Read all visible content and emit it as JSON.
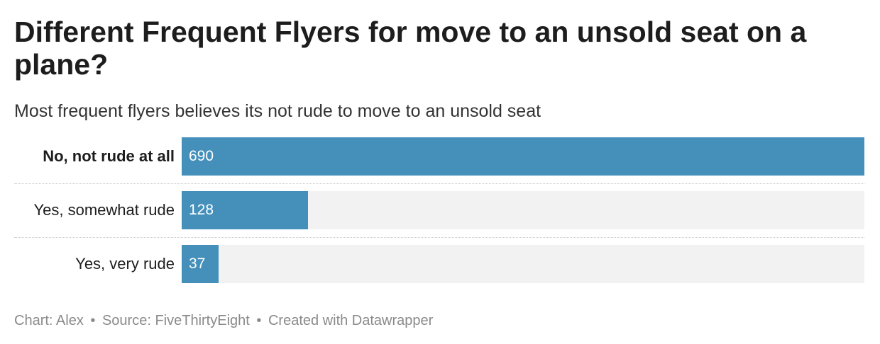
{
  "chart_data": {
    "type": "bar",
    "orientation": "horizontal",
    "title": "Different Frequent Flyers for move to an unsold seat on a plane?",
    "subtitle": "Most frequent flyers believes its not rude to move to an unsold seat",
    "categories": [
      "No, not rude at all",
      "Yes, somewhat rude",
      "Yes, very rude"
    ],
    "values": [
      690,
      128,
      37
    ],
    "xlim": [
      0,
      690
    ],
    "grid": false,
    "data_labels": true
  },
  "footer": {
    "chart_credit": "Chart: Alex",
    "source": "Source: FiveThirtyEight",
    "created_with": "Created with Datawrapper",
    "separator": "•"
  },
  "colors": {
    "bar": "#4490bb",
    "track": "#f2f2f2",
    "footer_text": "#8a8a8a"
  }
}
